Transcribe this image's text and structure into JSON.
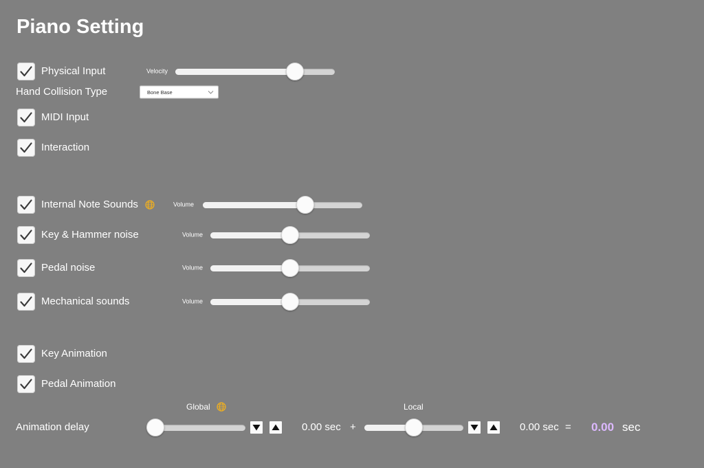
{
  "colors": {
    "background": "#808080",
    "text": "#ffffff",
    "total_value": "#dcb8ff",
    "globe": "#f2b01e",
    "checkmark": "#3a3a3a"
  },
  "page": {
    "title": "Piano Setting"
  },
  "physical_input": {
    "label": "Physical Input",
    "checked": true,
    "velocity_label": "Velocity",
    "velocity": 0.78
  },
  "hand_collision": {
    "label": "Hand Collision Type",
    "selected": "Bone Base",
    "icon": "chevron-down-icon"
  },
  "midi_input": {
    "label": "MIDI Input",
    "checked": true
  },
  "interaction": {
    "label": "Interaction",
    "checked": true
  },
  "sounds": [
    {
      "label": "Internal Note Sounds",
      "checked": true,
      "icon": "globe-icon",
      "volume_label": "Volume",
      "volume": 0.66
    },
    {
      "label": "Key & Hammer noise",
      "checked": true,
      "volume_label": "Volume",
      "volume": 0.5
    },
    {
      "label": "Pedal noise",
      "checked": true,
      "volume_label": "Volume",
      "volume": 0.5
    },
    {
      "label": "Mechanical sounds",
      "checked": true,
      "volume_label": "Volume",
      "volume": 0.5
    }
  ],
  "key_animation": {
    "label": "Key Animation",
    "checked": true
  },
  "pedal_animation": {
    "label": "Pedal Animation",
    "checked": true
  },
  "animation_delay": {
    "label": "Animation delay",
    "global": {
      "label": "Global",
      "icon": "globe-icon",
      "slider": 0.0,
      "value": "0.00",
      "unit": "sec"
    },
    "plus": "+",
    "local": {
      "label": "Local",
      "slider": 0.5,
      "value": "0.00",
      "unit": "sec"
    },
    "equals": "=",
    "total": {
      "value": "0.00",
      "unit": "sec"
    },
    "decrement_icon": "triangle-down-icon",
    "increment_icon": "triangle-up-icon"
  }
}
